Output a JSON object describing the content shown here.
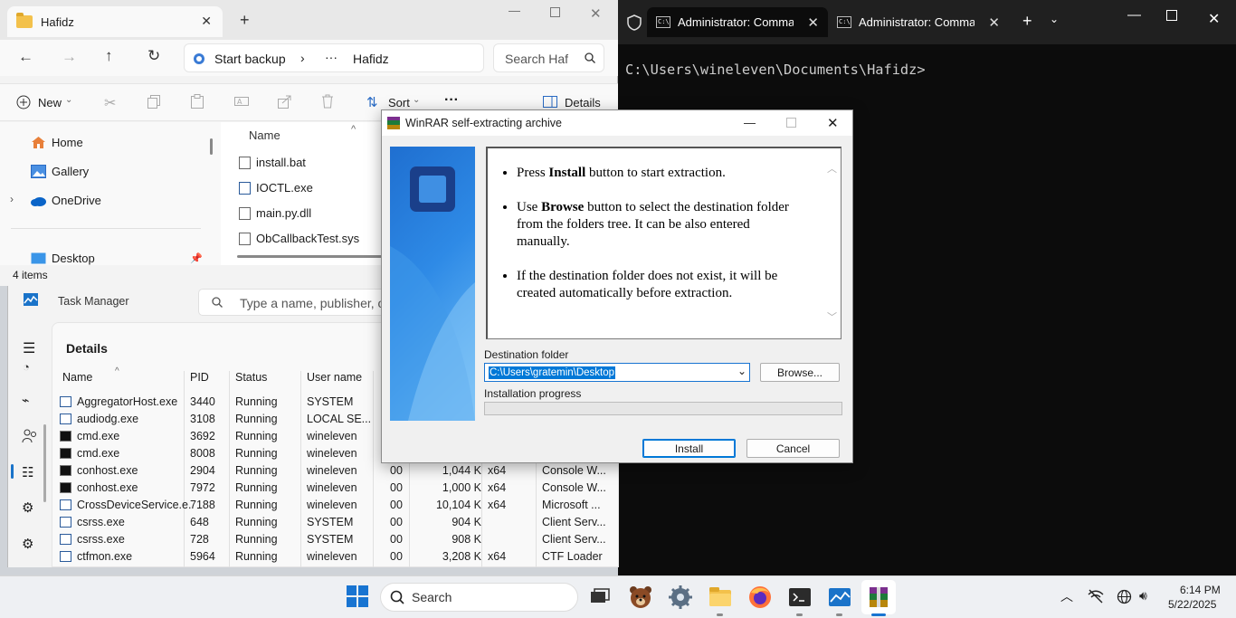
{
  "terminal": {
    "tabs": [
      {
        "label": "Administrator: Comma"
      },
      {
        "label": "Administrator: Comma"
      }
    ],
    "prompt": "C:\\Users\\wineleven\\Documents\\Hafidz>",
    "bg_color": "#0c0c0c"
  },
  "explorer": {
    "tab_title": "Hafidz",
    "breadcrumb": {
      "root": "Start backup",
      "ellipsis": "···",
      "current": "Hafidz"
    },
    "search_placeholder": "Search Haf",
    "toolbar": {
      "new_label": "New",
      "sort_label": "Sort",
      "more_label": "···",
      "details_label": "Details"
    },
    "nav": [
      {
        "label": "Home",
        "icon": "home-icon"
      },
      {
        "label": "Gallery",
        "icon": "gallery-icon"
      },
      {
        "label": "OneDrive",
        "icon": "cloud-icon"
      },
      {
        "label": "Desktop",
        "icon": "desktop-icon"
      }
    ],
    "column_name": "Name",
    "files": [
      "install.bat",
      "IOCTL.exe",
      "main.py.dll",
      "ObCallbackTest.sys"
    ],
    "status": "4 items"
  },
  "taskmanager": {
    "title": "Task Manager",
    "search_placeholder": "Type a name, publisher, o",
    "page_title": "Details",
    "columns": [
      "Name",
      "PID",
      "Status",
      "User name"
    ],
    "rows": [
      {
        "name": "AggregatorHost.exe",
        "pid": "3440",
        "status": "Running",
        "user": "SYSTEM",
        "cpu": "",
        "mem": "",
        "arch": "",
        "desc": ""
      },
      {
        "name": "audiodg.exe",
        "pid": "3108",
        "status": "Running",
        "user": "LOCAL SE...",
        "cpu": "",
        "mem": "",
        "arch": "",
        "desc": ""
      },
      {
        "name": "cmd.exe",
        "pid": "3692",
        "status": "Running",
        "user": "wineleven",
        "cpu": "",
        "mem": "",
        "arch": "",
        "desc": ""
      },
      {
        "name": "cmd.exe",
        "pid": "8008",
        "status": "Running",
        "user": "wineleven",
        "cpu": "",
        "mem": "",
        "arch": "",
        "desc": ""
      },
      {
        "name": "conhost.exe",
        "pid": "2904",
        "status": "Running",
        "user": "wineleven",
        "cpu": "00",
        "mem": "1,044 K",
        "arch": "x64",
        "desc": "Console W..."
      },
      {
        "name": "conhost.exe",
        "pid": "7972",
        "status": "Running",
        "user": "wineleven",
        "cpu": "00",
        "mem": "1,000 K",
        "arch": "x64",
        "desc": "Console W..."
      },
      {
        "name": "CrossDeviceService.e...",
        "pid": "7188",
        "status": "Running",
        "user": "wineleven",
        "cpu": "00",
        "mem": "10,104 K",
        "arch": "x64",
        "desc": "Microsoft ..."
      },
      {
        "name": "csrss.exe",
        "pid": "648",
        "status": "Running",
        "user": "SYSTEM",
        "cpu": "00",
        "mem": "904 K",
        "arch": "",
        "desc": "Client Serv..."
      },
      {
        "name": "csrss.exe",
        "pid": "728",
        "status": "Running",
        "user": "SYSTEM",
        "cpu": "00",
        "mem": "908 K",
        "arch": "",
        "desc": "Client Serv..."
      },
      {
        "name": "ctfmon.exe",
        "pid": "5964",
        "status": "Running",
        "user": "wineleven",
        "cpu": "00",
        "mem": "3,208 K",
        "arch": "x64",
        "desc": "CTF Loader"
      }
    ]
  },
  "winrar": {
    "title": "WinRAR self-extracting archive",
    "instructions": [
      {
        "pre": "Press ",
        "bold": "Install",
        "post": " button to start extraction."
      },
      {
        "pre": "Use ",
        "bold": "Browse",
        "post": " button to select the destination folder from the folders tree. It can be also entered manually."
      },
      {
        "pre": "",
        "bold": "",
        "post": "If the destination folder does not exist, it will be created automatically before extraction."
      }
    ],
    "dest_label": "Destination folder",
    "dest_value": "C:\\Users\\gratemin\\Desktop",
    "browse_label": "Browse...",
    "progress_label": "Installation progress",
    "progress_value": 0,
    "install_label": "Install",
    "cancel_label": "Cancel"
  },
  "taskbar": {
    "search_label": "Search",
    "time": "6:14 PM",
    "date": "5/22/2025"
  }
}
